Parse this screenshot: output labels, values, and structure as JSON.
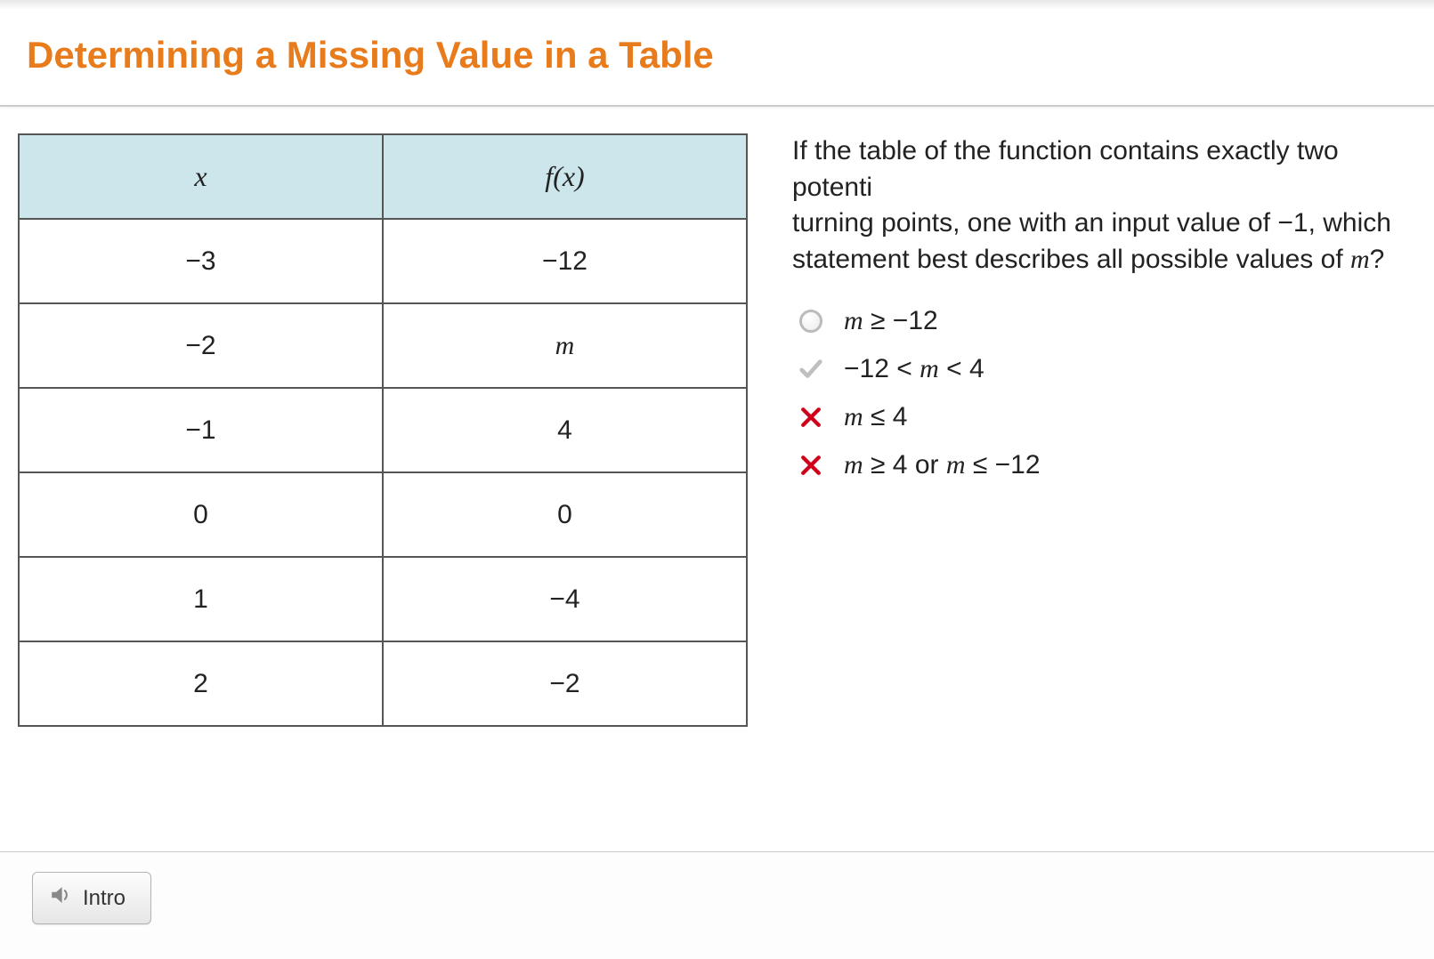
{
  "header": {
    "title": "Determining a Missing Value in a Table"
  },
  "table": {
    "headers": {
      "x": "x",
      "fx_f": "f",
      "fx_open": "(",
      "fx_x": "x",
      "fx_close": ")"
    },
    "rows": [
      {
        "x": "−3",
        "fx": "−12"
      },
      {
        "x": "−2",
        "fx": "m"
      },
      {
        "x": "−1",
        "fx": "4"
      },
      {
        "x": "0",
        "fx": "0"
      },
      {
        "x": "1",
        "fx": "−4"
      },
      {
        "x": "2",
        "fx": "−2"
      }
    ]
  },
  "question": {
    "p1": "If the table of the function contains exactly two potenti",
    "p2": "turning points, one with an input value of −1, which",
    "p3a": "statement best describes all possible values of ",
    "m": "m",
    "p3b": "?"
  },
  "options": [
    {
      "state": "unselected",
      "m1": "m",
      "t1": " ≥ −12"
    },
    {
      "state": "correct",
      "t0": "−12 < ",
      "m1": "m",
      "t1": " < 4"
    },
    {
      "state": "wrong",
      "m1": "m",
      "t1": " ≤ 4"
    },
    {
      "state": "wrong",
      "m1": "m",
      "t1": " ≥ 4 or ",
      "m2": "m",
      "t2": " ≤ −12"
    }
  ],
  "footer": {
    "intro_label": "Intro"
  }
}
